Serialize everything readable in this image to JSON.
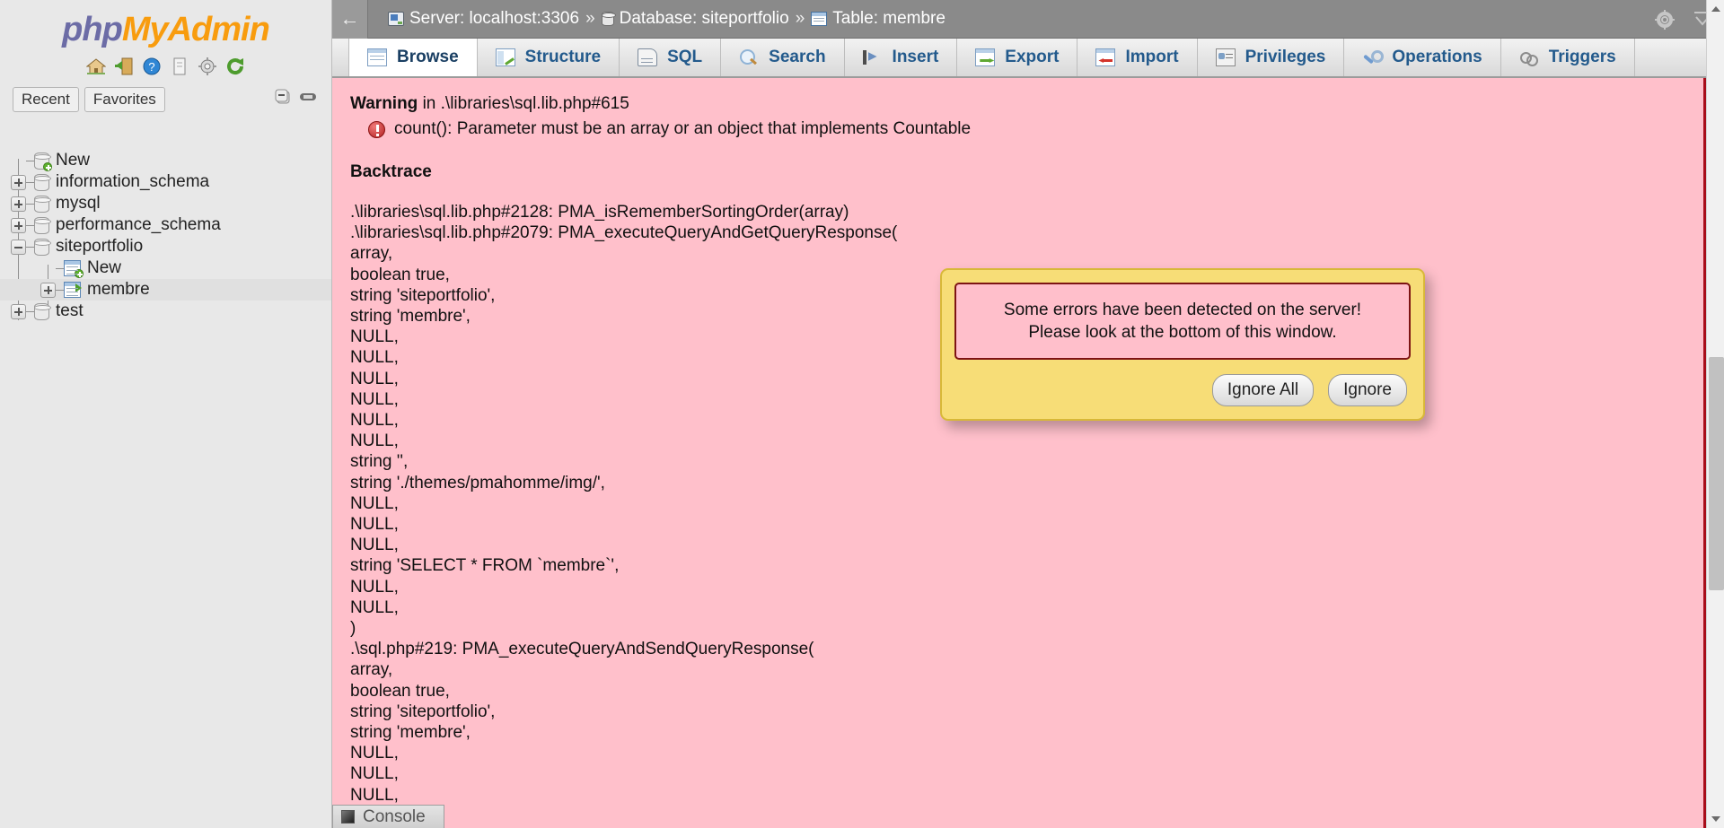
{
  "brand": {
    "php": "php",
    "myadmin": "MyAdmin"
  },
  "brand_icons": [
    {
      "name": "home-icon",
      "label": "Home"
    },
    {
      "name": "logout-icon",
      "label": "Log out"
    },
    {
      "name": "help-icon",
      "label": "phpMyAdmin documentation"
    },
    {
      "name": "docs-icon",
      "label": "Documentation"
    },
    {
      "name": "settings-icon",
      "label": "Settings"
    },
    {
      "name": "reload-icon",
      "label": "Reload navigation"
    }
  ],
  "quick_tabs": [
    {
      "label": "Recent"
    },
    {
      "label": "Favorites"
    }
  ],
  "tree_controls": [
    {
      "name": "collapse-all-icon"
    },
    {
      "name": "link-with-main-panel-icon"
    }
  ],
  "tree": [
    {
      "label": "New",
      "level": 1,
      "toggle": "none",
      "icon": "new-database-icon",
      "selected": false
    },
    {
      "label": "information_schema",
      "level": 1,
      "toggle": "plus",
      "icon": "database-icon",
      "selected": false
    },
    {
      "label": "mysql",
      "level": 1,
      "toggle": "plus",
      "icon": "database-icon",
      "selected": false
    },
    {
      "label": "performance_schema",
      "level": 1,
      "toggle": "plus",
      "icon": "database-icon",
      "selected": false
    },
    {
      "label": "siteportfolio",
      "level": 1,
      "toggle": "minus",
      "icon": "database-icon",
      "selected": false
    },
    {
      "label": "New",
      "level": 2,
      "toggle": "none",
      "icon": "new-table-icon",
      "selected": false
    },
    {
      "label": "membre",
      "level": 2,
      "toggle": "plus",
      "icon": "table-icon",
      "selected": true
    },
    {
      "label": "test",
      "level": 1,
      "toggle": "plus",
      "icon": "database-icon",
      "selected": false
    }
  ],
  "topbar": {
    "back_glyph": "←",
    "breadcrumbs": [
      {
        "icon": "server-icon",
        "label": "Server: localhost:3306"
      },
      {
        "icon": "database-icon",
        "label": "Database: siteportfolio"
      },
      {
        "icon": "table-icon",
        "label": "Table: membre"
      }
    ],
    "separator": "»",
    "right_icons": [
      {
        "name": "gear-icon"
      },
      {
        "name": "collapse-panel-icon"
      }
    ]
  },
  "tabs": [
    {
      "label": "Browse",
      "icon": "browse-icon",
      "active": true
    },
    {
      "label": "Structure",
      "icon": "structure-icon",
      "active": false
    },
    {
      "label": "SQL",
      "icon": "sql-icon",
      "active": false
    },
    {
      "label": "Search",
      "icon": "search-icon",
      "active": false
    },
    {
      "label": "Insert",
      "icon": "insert-icon",
      "active": false
    },
    {
      "label": "Export",
      "icon": "export-icon",
      "active": false
    },
    {
      "label": "Import",
      "icon": "import-icon",
      "active": false
    },
    {
      "label": "Privileges",
      "icon": "privileges-icon",
      "active": false
    },
    {
      "label": "Operations",
      "icon": "operations-icon",
      "active": false
    },
    {
      "label": "Triggers",
      "icon": "triggers-icon",
      "active": false
    }
  ],
  "error_panel": {
    "warning_word": "Warning",
    "warning_rest": " in .\\libraries\\sql.lib.php#615",
    "message": "count(): Parameter must be an array or an object that implements Countable",
    "backtrace_heading": "Backtrace",
    "backtrace": ".\\libraries\\sql.lib.php#2128: PMA_isRememberSortingOrder(array)\n.\\libraries\\sql.lib.php#2079: PMA_executeQueryAndGetQueryResponse(\narray,\nboolean true,\nstring 'siteportfolio',\nstring 'membre',\nNULL,\nNULL,\nNULL,\nNULL,\nNULL,\nNULL,\nstring '',\nstring './themes/pmahomme/img/',\nNULL,\nNULL,\nNULL,\nstring 'SELECT * FROM `membre`',\nNULL,\nNULL,\n)\n.\\sql.php#219: PMA_executeQueryAndSendQueryResponse(\narray,\nboolean true,\nstring 'siteportfolio',\nstring 'membre',\nNULL,\nNULL,\nNULL,\nNULL,"
  },
  "dialog": {
    "line1": "Some errors have been detected on the server!",
    "line2": "Please look at the bottom of this window.",
    "ignore_all_label": "Ignore All",
    "ignore_label": "Ignore"
  },
  "console": {
    "label": "Console"
  },
  "colors": {
    "error_bg": "#ffc0cb",
    "dialog_bg": "#f7dd77",
    "dialog_border": "#d8b838",
    "dialog_msg_border": "#7d1414",
    "brand_php": "#6c6ca6",
    "brand_myadmin": "#f89c0e",
    "tab_text": "#235a8c",
    "topbar_bg": "#8a8a8a"
  }
}
